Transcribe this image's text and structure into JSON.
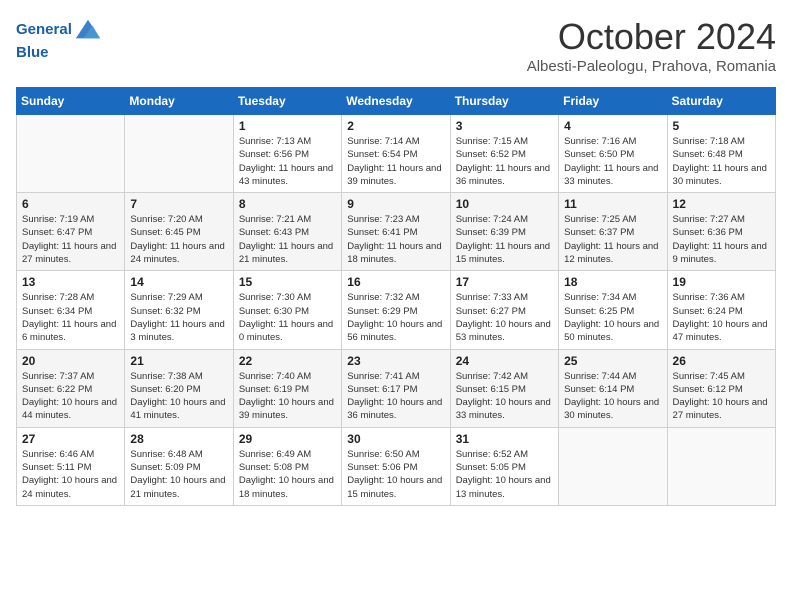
{
  "header": {
    "logo_line1": "General",
    "logo_line2": "Blue",
    "month": "October 2024",
    "location": "Albesti-Paleologu, Prahova, Romania"
  },
  "days_of_week": [
    "Sunday",
    "Monday",
    "Tuesday",
    "Wednesday",
    "Thursday",
    "Friday",
    "Saturday"
  ],
  "weeks": [
    [
      {
        "day": "",
        "info": ""
      },
      {
        "day": "",
        "info": ""
      },
      {
        "day": "1",
        "info": "Sunrise: 7:13 AM\nSunset: 6:56 PM\nDaylight: 11 hours and 43 minutes."
      },
      {
        "day": "2",
        "info": "Sunrise: 7:14 AM\nSunset: 6:54 PM\nDaylight: 11 hours and 39 minutes."
      },
      {
        "day": "3",
        "info": "Sunrise: 7:15 AM\nSunset: 6:52 PM\nDaylight: 11 hours and 36 minutes."
      },
      {
        "day": "4",
        "info": "Sunrise: 7:16 AM\nSunset: 6:50 PM\nDaylight: 11 hours and 33 minutes."
      },
      {
        "day": "5",
        "info": "Sunrise: 7:18 AM\nSunset: 6:48 PM\nDaylight: 11 hours and 30 minutes."
      }
    ],
    [
      {
        "day": "6",
        "info": "Sunrise: 7:19 AM\nSunset: 6:47 PM\nDaylight: 11 hours and 27 minutes."
      },
      {
        "day": "7",
        "info": "Sunrise: 7:20 AM\nSunset: 6:45 PM\nDaylight: 11 hours and 24 minutes."
      },
      {
        "day": "8",
        "info": "Sunrise: 7:21 AM\nSunset: 6:43 PM\nDaylight: 11 hours and 21 minutes."
      },
      {
        "day": "9",
        "info": "Sunrise: 7:23 AM\nSunset: 6:41 PM\nDaylight: 11 hours and 18 minutes."
      },
      {
        "day": "10",
        "info": "Sunrise: 7:24 AM\nSunset: 6:39 PM\nDaylight: 11 hours and 15 minutes."
      },
      {
        "day": "11",
        "info": "Sunrise: 7:25 AM\nSunset: 6:37 PM\nDaylight: 11 hours and 12 minutes."
      },
      {
        "day": "12",
        "info": "Sunrise: 7:27 AM\nSunset: 6:36 PM\nDaylight: 11 hours and 9 minutes."
      }
    ],
    [
      {
        "day": "13",
        "info": "Sunrise: 7:28 AM\nSunset: 6:34 PM\nDaylight: 11 hours and 6 minutes."
      },
      {
        "day": "14",
        "info": "Sunrise: 7:29 AM\nSunset: 6:32 PM\nDaylight: 11 hours and 3 minutes."
      },
      {
        "day": "15",
        "info": "Sunrise: 7:30 AM\nSunset: 6:30 PM\nDaylight: 11 hours and 0 minutes."
      },
      {
        "day": "16",
        "info": "Sunrise: 7:32 AM\nSunset: 6:29 PM\nDaylight: 10 hours and 56 minutes."
      },
      {
        "day": "17",
        "info": "Sunrise: 7:33 AM\nSunset: 6:27 PM\nDaylight: 10 hours and 53 minutes."
      },
      {
        "day": "18",
        "info": "Sunrise: 7:34 AM\nSunset: 6:25 PM\nDaylight: 10 hours and 50 minutes."
      },
      {
        "day": "19",
        "info": "Sunrise: 7:36 AM\nSunset: 6:24 PM\nDaylight: 10 hours and 47 minutes."
      }
    ],
    [
      {
        "day": "20",
        "info": "Sunrise: 7:37 AM\nSunset: 6:22 PM\nDaylight: 10 hours and 44 minutes."
      },
      {
        "day": "21",
        "info": "Sunrise: 7:38 AM\nSunset: 6:20 PM\nDaylight: 10 hours and 41 minutes."
      },
      {
        "day": "22",
        "info": "Sunrise: 7:40 AM\nSunset: 6:19 PM\nDaylight: 10 hours and 39 minutes."
      },
      {
        "day": "23",
        "info": "Sunrise: 7:41 AM\nSunset: 6:17 PM\nDaylight: 10 hours and 36 minutes."
      },
      {
        "day": "24",
        "info": "Sunrise: 7:42 AM\nSunset: 6:15 PM\nDaylight: 10 hours and 33 minutes."
      },
      {
        "day": "25",
        "info": "Sunrise: 7:44 AM\nSunset: 6:14 PM\nDaylight: 10 hours and 30 minutes."
      },
      {
        "day": "26",
        "info": "Sunrise: 7:45 AM\nSunset: 6:12 PM\nDaylight: 10 hours and 27 minutes."
      }
    ],
    [
      {
        "day": "27",
        "info": "Sunrise: 6:46 AM\nSunset: 5:11 PM\nDaylight: 10 hours and 24 minutes."
      },
      {
        "day": "28",
        "info": "Sunrise: 6:48 AM\nSunset: 5:09 PM\nDaylight: 10 hours and 21 minutes."
      },
      {
        "day": "29",
        "info": "Sunrise: 6:49 AM\nSunset: 5:08 PM\nDaylight: 10 hours and 18 minutes."
      },
      {
        "day": "30",
        "info": "Sunrise: 6:50 AM\nSunset: 5:06 PM\nDaylight: 10 hours and 15 minutes."
      },
      {
        "day": "31",
        "info": "Sunrise: 6:52 AM\nSunset: 5:05 PM\nDaylight: 10 hours and 13 minutes."
      },
      {
        "day": "",
        "info": ""
      },
      {
        "day": "",
        "info": ""
      }
    ]
  ]
}
